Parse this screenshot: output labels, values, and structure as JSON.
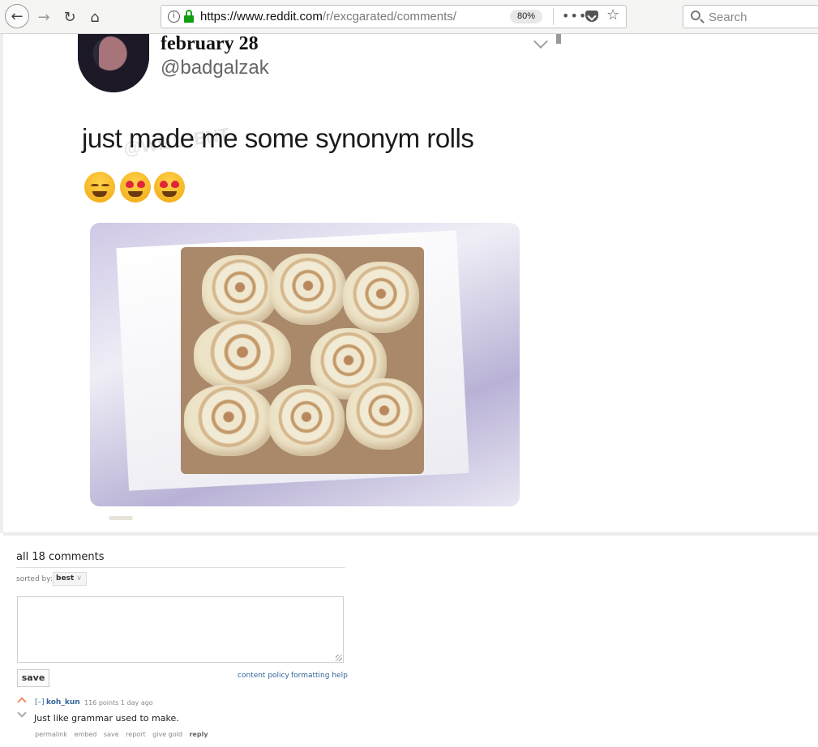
{
  "browser": {
    "url_host": "https://www.reddit.com",
    "url_path": "/r/excgarated/comments/",
    "zoom": "80%",
    "search_placeholder": "Search"
  },
  "tweet": {
    "name": "february 28",
    "handle": "@badgalzak",
    "text": "just made me some synonym rolls",
    "watermark": "@WILL_ENT"
  },
  "comments": {
    "header": "all 18 comments",
    "sorted_by_label": "sorted by:",
    "sort_value": "best",
    "save_label": "save",
    "content_policy": "content policy",
    "formatting_help": "formatting help",
    "items": [
      {
        "toggle": "[–]",
        "author": "koh_kun",
        "meta": "116 points 1 day ago",
        "body": "Just like grammar used to make.",
        "actions": {
          "permalink": "permalink",
          "embed": "embed",
          "save": "save",
          "report": "report",
          "give_gold": "give gold",
          "reply": "reply"
        }
      }
    ]
  }
}
